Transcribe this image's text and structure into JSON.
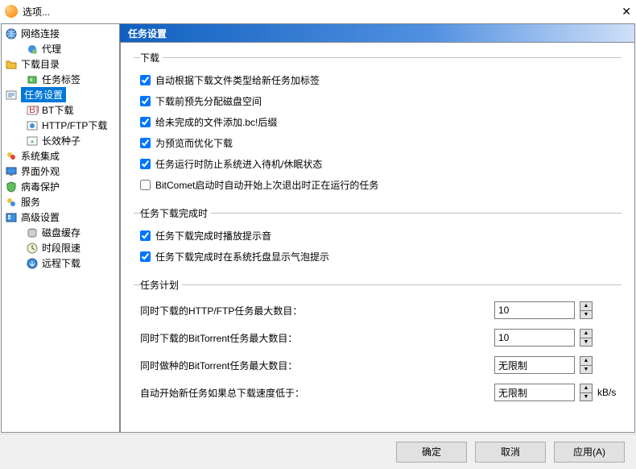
{
  "window": {
    "title": "选项..."
  },
  "sidebar": {
    "items": [
      {
        "label": "网络连接"
      },
      {
        "label": "代理"
      },
      {
        "label": "下载目录"
      },
      {
        "label": "任务标签"
      },
      {
        "label": "任务设置"
      },
      {
        "label": "BT下载"
      },
      {
        "label": "HTTP/FTP下载"
      },
      {
        "label": "长效种子"
      },
      {
        "label": "系统集成"
      },
      {
        "label": "界面外观"
      },
      {
        "label": "病毒保护"
      },
      {
        "label": "服务"
      },
      {
        "label": "高级设置"
      },
      {
        "label": "磁盘缓存"
      },
      {
        "label": "时段限速"
      },
      {
        "label": "远程下载"
      }
    ]
  },
  "header": {
    "title": "任务设置"
  },
  "section_download": {
    "legend": "下载",
    "c1": "自动根据下载文件类型给新任务加标签",
    "c2": "下载前预先分配磁盘空间",
    "c3": "给未完成的文件添加.bc!后缀",
    "c4": "为预览而优化下载",
    "c5": "任务运行时防止系统进入待机/休眠状态",
    "c6": "BitComet启动时自动开始上次退出时正在运行的任务"
  },
  "section_complete": {
    "legend": "任务下载完成时",
    "c1": "任务下载完成时播放提示音",
    "c2": "任务下载完成时在系统托盘显示气泡提示"
  },
  "section_plan": {
    "legend": "任务计划",
    "r1_label": "同时下载的HTTP/FTP任务最大数目：",
    "r1_value": "10",
    "r2_label": "同时下载的BitTorrent任务最大数目：",
    "r2_value": "10",
    "r3_label": "同时做种的BitTorrent任务最大数目：",
    "r3_value": "无限制",
    "r4_label": "自动开始新任务如果总下载速度低于：",
    "r4_value": "无限制",
    "r4_unit": "kB/s"
  },
  "buttons": {
    "ok": "确定",
    "cancel": "取消",
    "apply": "应用(A)"
  }
}
